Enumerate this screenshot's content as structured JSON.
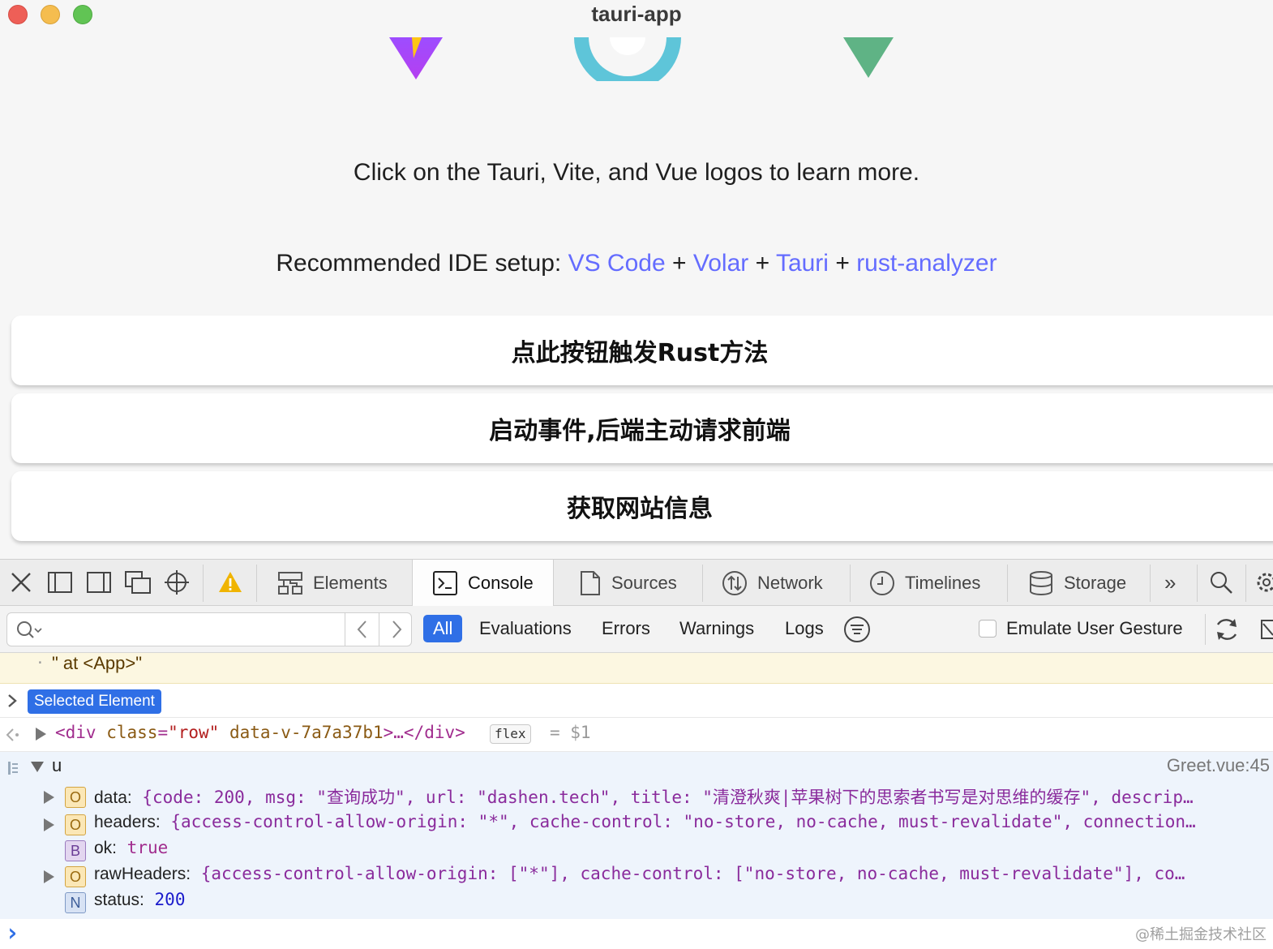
{
  "window": {
    "title": "tauri-app"
  },
  "app": {
    "hint_text": "Click on the Tauri, Vite, and Vue logos to learn more.",
    "ide_prefix": "Recommended IDE setup:",
    "ide_links": [
      "VS Code",
      "Volar",
      "Tauri",
      "rust-analyzer"
    ],
    "plus": "+",
    "buttons": [
      "点此按钮触发Rust方法",
      "启动事件,后端主动请求前端",
      "获取网站信息"
    ]
  },
  "devtools": {
    "tabs": [
      "Elements",
      "Console",
      "Sources",
      "Network",
      "Timelines",
      "Storage"
    ],
    "active_tab": "Console",
    "more_glyph": "»",
    "filters": [
      "All",
      "Evaluations",
      "Errors",
      "Warnings",
      "Logs"
    ],
    "active_filter": "All",
    "search_placeholder": "",
    "emulate_label": "Emulate User Gesture",
    "console": {
      "warn_line": "\" at <App>\"",
      "selected_label": "Selected Element",
      "result": {
        "open_tag": "<div",
        "attr1_name": "class",
        "attr1_val": "\"row\"",
        "attr2_name": "data-v-7a7a37b1",
        "tail": ">…</div>",
        "badge": "flex",
        "assign": "= $1"
      },
      "log": {
        "var_name": "u",
        "source": "Greet.vue:45",
        "props": [
          {
            "badge": "O",
            "name": "data:",
            "value": "{code: 200, msg: \"查询成功\", url: \"dashen.tech\", title: \"清澄秋爽|苹果树下的思索者书写是对思维的缓存\", descrip…"
          },
          {
            "badge": "O",
            "name": "headers:",
            "value": "{access-control-allow-origin: \"*\", cache-control: \"no-store, no-cache, must-revalidate\", connection…"
          },
          {
            "badge": "B",
            "name": "ok:",
            "value": "true"
          },
          {
            "badge": "O",
            "name": "rawHeaders:",
            "value": "{access-control-allow-origin: [\"*\"], cache-control: [\"no-store, no-cache, must-revalidate\"], co…"
          },
          {
            "badge": "N",
            "name": "status:",
            "value": "200"
          }
        ]
      },
      "prompt_glyph": "›"
    }
  },
  "watermark": "@稀土掘金技术社区",
  "colors": {
    "link": "#646cff",
    "accent": "#2f6fe6",
    "warn_bg": "#fcf7e1",
    "log_bg": "#eef4fc"
  }
}
